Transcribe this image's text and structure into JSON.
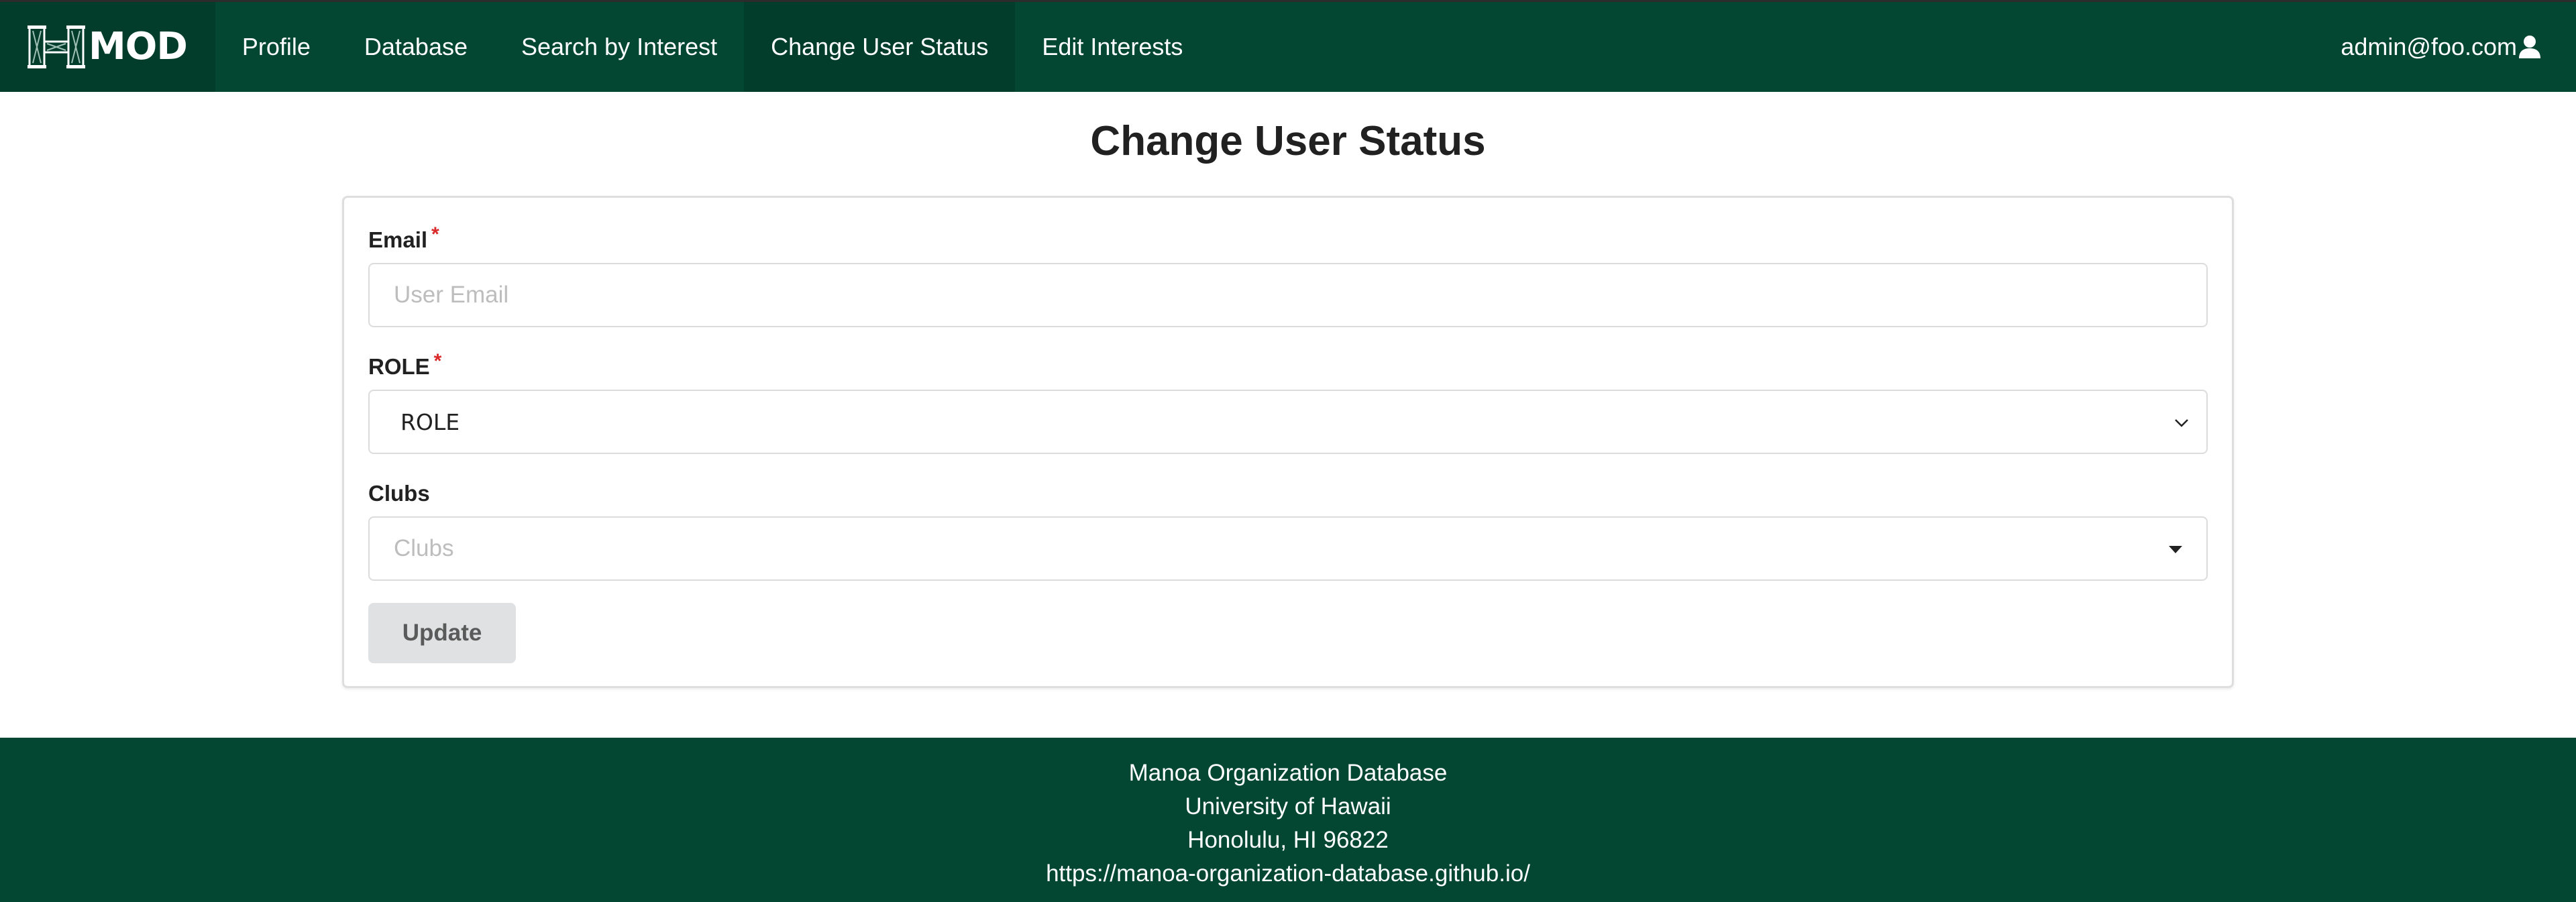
{
  "navbar": {
    "brand_text": "MOD",
    "items": [
      {
        "label": "Profile"
      },
      {
        "label": "Database"
      },
      {
        "label": "Search by Interest"
      },
      {
        "label": "Change User Status"
      },
      {
        "label": "Edit Interests"
      }
    ],
    "active_item": "Change User Status",
    "user_email": "admin@foo.com",
    "brand_color": "#034732"
  },
  "page": {
    "title": "Change User Status"
  },
  "form": {
    "email_label": "Email",
    "email_required": "*",
    "email_placeholder": "User Email",
    "email_value": "",
    "role_label": "ROLE",
    "role_required": "*",
    "role_selected": "ROLE",
    "clubs_label": "Clubs",
    "clubs_placeholder": "Clubs",
    "update_label": "Update"
  },
  "footer": {
    "lines": [
      "Manoa Organization Database",
      "University of Hawaii",
      "Honolulu, HI 96822",
      "https://manoa-organization-database.github.io/"
    ]
  }
}
